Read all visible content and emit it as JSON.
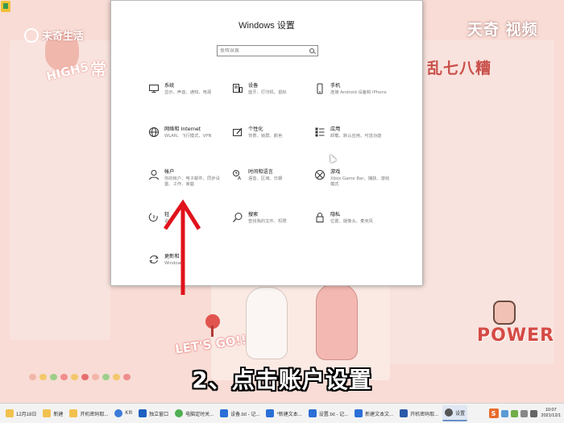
{
  "window": {
    "heading": "Windows 设置",
    "search_placeholder": "查找设置"
  },
  "categories": [
    {
      "id": "system",
      "title": "系统",
      "desc": "显示、声音、通知、电源",
      "icon": "monitor-icon"
    },
    {
      "id": "devices",
      "title": "设备",
      "desc": "蓝牙、打印机、鼠标",
      "icon": "keyboard-devices-icon"
    },
    {
      "id": "phone",
      "title": "手机",
      "desc": "连接 Android 设备和 iPhone",
      "icon": "phone-icon"
    },
    {
      "id": "network",
      "title": "网络和 Internet",
      "desc": "WLAN、飞行模式、VPN",
      "icon": "globe-icon"
    },
    {
      "id": "personalization",
      "title": "个性化",
      "desc": "背景、锁屏、颜色",
      "icon": "brush-icon"
    },
    {
      "id": "apps",
      "title": "应用",
      "desc": "卸载、默认应用、可选功能",
      "icon": "apps-list-icon"
    },
    {
      "id": "accounts",
      "title": "帐户",
      "desc": "你的帐户、电子邮件、同步设置、工作、家庭",
      "icon": "person-icon"
    },
    {
      "id": "time",
      "title": "时间和语言",
      "desc": "语音、区域、日期",
      "icon": "time-language-icon"
    },
    {
      "id": "gaming",
      "title": "游戏",
      "desc": "Xbox Game Bar、捕获、游戏模式",
      "icon": "xbox-icon"
    },
    {
      "id": "ease",
      "title": "轻",
      "desc": "讲",
      "icon": "ease-of-access-icon"
    },
    {
      "id": "search",
      "title": "搜索",
      "desc": "查找我的文件、权限",
      "icon": "magnifier-icon"
    },
    {
      "id": "privacy",
      "title": "隐私",
      "desc": "位置、摄像头、麦克风",
      "icon": "lock-icon"
    },
    {
      "id": "update",
      "title": "更新和",
      "desc": "Windows",
      "icon": "refresh-icon"
    }
  ],
  "caption": "2、点击账户设置",
  "watermarks": {
    "left": "未奇生活",
    "right": "天奇 视频"
  },
  "stickers": {
    "high5": "HIGH5",
    "changwen": "常",
    "luan": "乱七八糟",
    "power": "POWER",
    "letsgo": "LET'S GO!!!"
  },
  "taskbar": {
    "items": [
      {
        "label": "12月18日",
        "color": "#f2c14e"
      },
      {
        "label": "新建",
        "color": "#f2c14e"
      },
      {
        "label": "开机密码取...",
        "color": "#f2c14e"
      },
      {
        "label": "K!fi",
        "color": "#3d7bd9"
      },
      {
        "label": "独立窗口",
        "color": "#1f5fbf"
      },
      {
        "label": "电脑定时关...",
        "color": "#4caf50"
      },
      {
        "label": "设备.txt - 记...",
        "color": "#2b6fd6"
      },
      {
        "label": "*新建文本...",
        "color": "#2b6fd6"
      },
      {
        "label": "设置.txt - 记...",
        "color": "#2b6fd6"
      },
      {
        "label": "新建文本文...",
        "color": "#2b6fd6"
      },
      {
        "label": "开机密码取...",
        "color": "#2b5aa8"
      },
      {
        "label": "设置",
        "color": "#555555",
        "active": true
      }
    ],
    "clock_time": "10:07",
    "clock_date": "2021/12/1",
    "ime": "S"
  },
  "colors": {
    "wallpaper": "#f8dcd5",
    "arrow": "#e0121b",
    "accent": "#0078d7"
  }
}
